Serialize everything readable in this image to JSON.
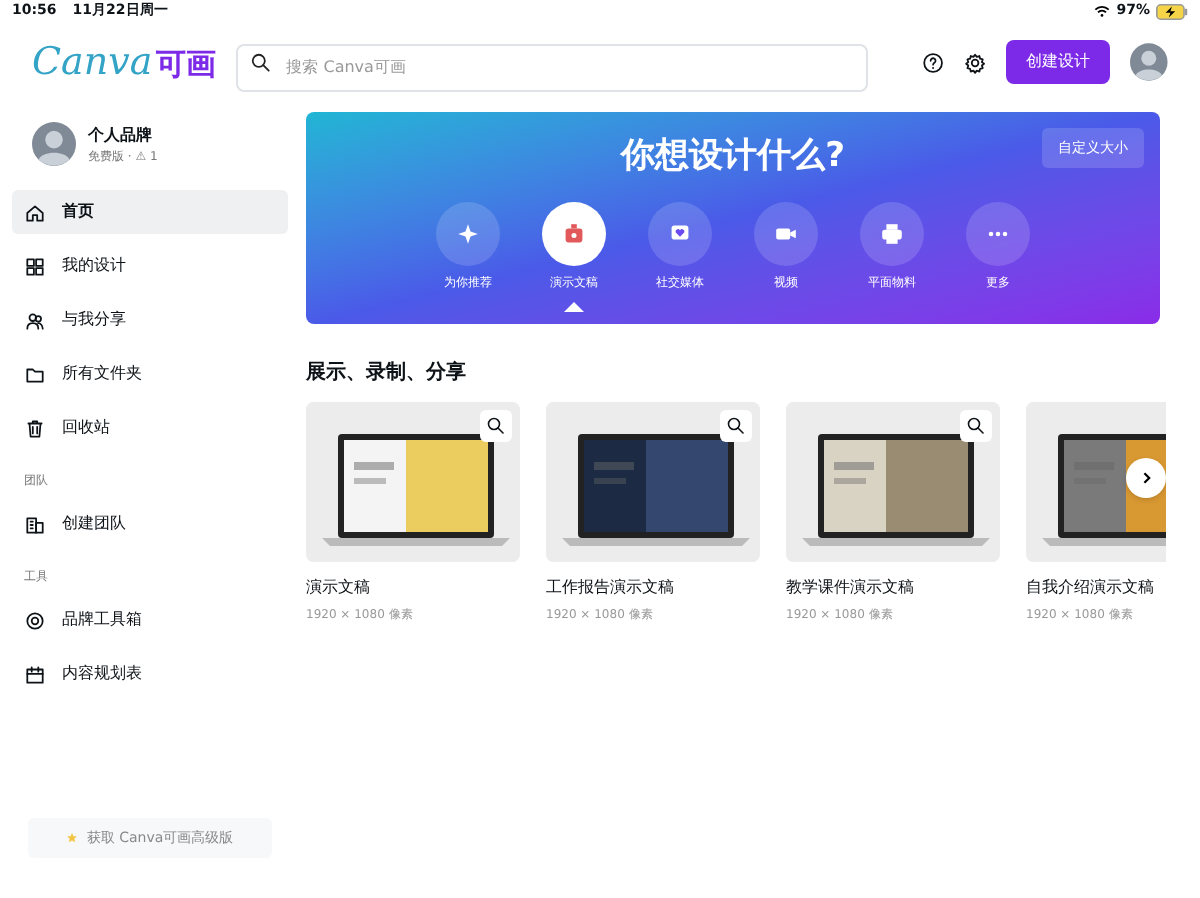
{
  "status_bar": {
    "time": "10:56",
    "date": "11月22日周一",
    "battery": "97%"
  },
  "header": {
    "logo_text": "Canva",
    "logo_cn": "可画",
    "search": {
      "placeholder": "搜索 Canva可画"
    },
    "create_button": "创建设计"
  },
  "sidebar": {
    "profile": {
      "name": "个人品牌",
      "plan": "免费版 · ⚠ 1"
    },
    "items": [
      {
        "label": "首页",
        "kind": "home",
        "selected": true
      },
      {
        "label": "我的设计",
        "kind": "grid",
        "selected": false
      },
      {
        "label": "与我分享",
        "kind": "people",
        "selected": false
      },
      {
        "label": "所有文件夹",
        "kind": "folder",
        "selected": false
      },
      {
        "label": "回收站",
        "kind": "trash",
        "selected": false
      }
    ],
    "team_heading": "团队",
    "team_items": [
      {
        "label": "创建团队",
        "kind": "team",
        "selected": false
      }
    ],
    "tools_heading": "工具",
    "tool_items": [
      {
        "label": "品牌工具箱",
        "kind": "brand",
        "selected": false
      },
      {
        "label": "内容规划表",
        "kind": "calendar",
        "selected": false
      }
    ],
    "upgrade": "获取 Canva可画高级版"
  },
  "banner": {
    "title": "你想设计什么?",
    "custom_size": "自定义大小",
    "categories": [
      {
        "label": "为你推荐",
        "kind": "sparkle",
        "selected": false
      },
      {
        "label": "演示文稿",
        "kind": "presentation",
        "selected": true
      },
      {
        "label": "社交媒体",
        "kind": "heart",
        "selected": false
      },
      {
        "label": "视频",
        "kind": "video",
        "selected": false
      },
      {
        "label": "平面物料",
        "kind": "print",
        "selected": false
      },
      {
        "label": "更多",
        "kind": "more",
        "selected": false
      }
    ]
  },
  "section": {
    "title": "展示、录制、分享",
    "cards": [
      {
        "title": "演示文稿",
        "size": "1920 × 1080 像素",
        "kind": "picture"
      },
      {
        "title": "工作报告演示文稿",
        "size": "1920 × 1080 像素",
        "kind": "picture"
      },
      {
        "title": "教学课件演示文稿",
        "size": "1920 × 1080 像素",
        "kind": "picture"
      },
      {
        "title": "自我介绍演示文稿",
        "size": "1920 × 1080 像素",
        "kind": "picture"
      }
    ]
  }
}
